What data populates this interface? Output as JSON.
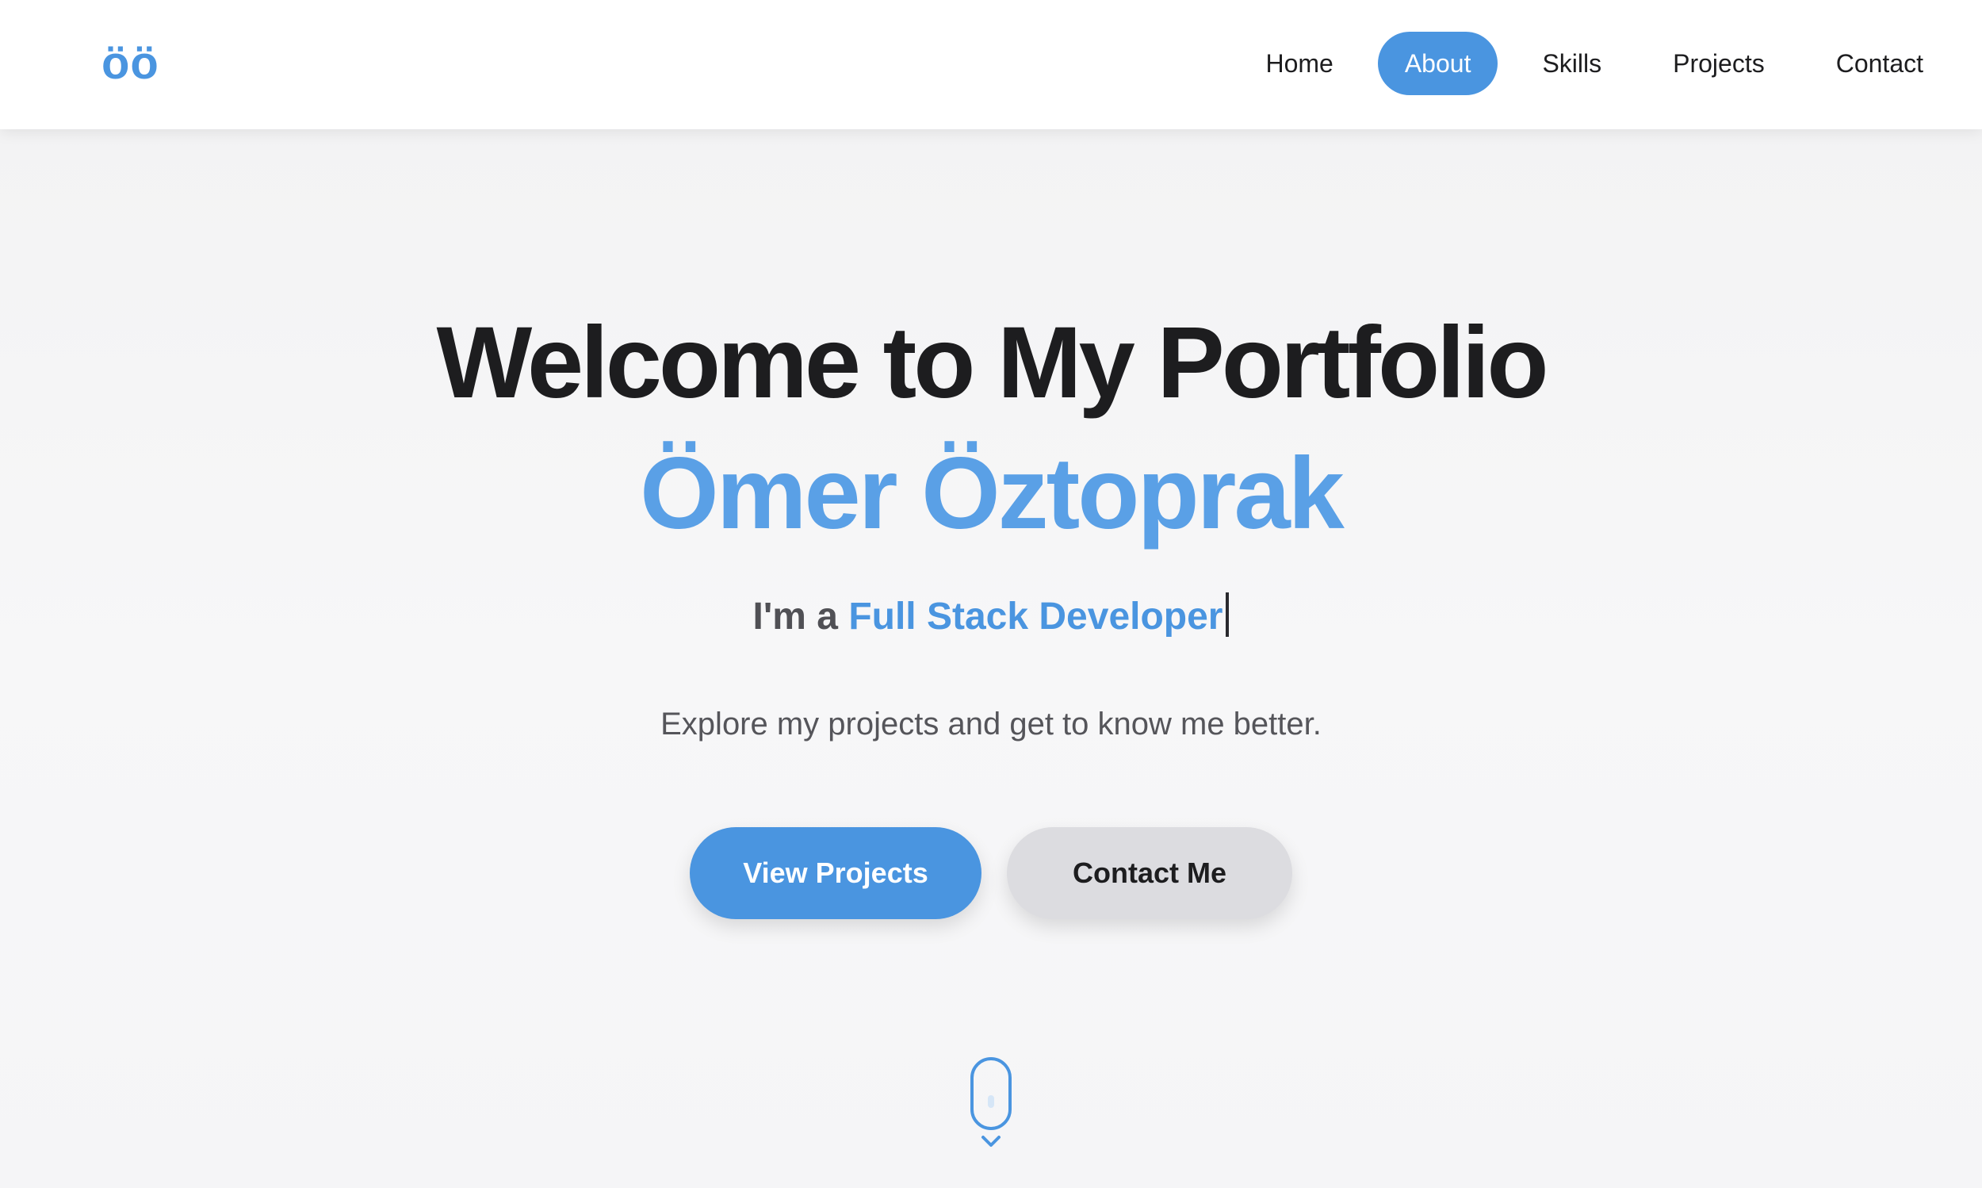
{
  "nav": {
    "logo": "öö",
    "links": [
      {
        "label": "Home",
        "active": false
      },
      {
        "label": "About",
        "active": true
      },
      {
        "label": "Skills",
        "active": false
      },
      {
        "label": "Projects",
        "active": false
      },
      {
        "label": "Contact",
        "active": false
      }
    ]
  },
  "hero": {
    "title": "Welcome to My Portfolio",
    "name": "Ömer Öztoprak",
    "role_prefix": "I'm a ",
    "role": "Full Stack Developer",
    "subtitle": "Explore my projects and get to know me better.",
    "primary_button": "View Projects",
    "secondary_button": "Contact Me"
  },
  "icons": {
    "scroll_mouse": "mouse-scroll-icon",
    "scroll_arrow": "chevron-down-icon"
  },
  "colors": {
    "accent": "#4a95e0",
    "name_color": "#5aa0e6",
    "text_dark": "#1d1d1f",
    "secondary_button_bg": "#dcdce0"
  }
}
